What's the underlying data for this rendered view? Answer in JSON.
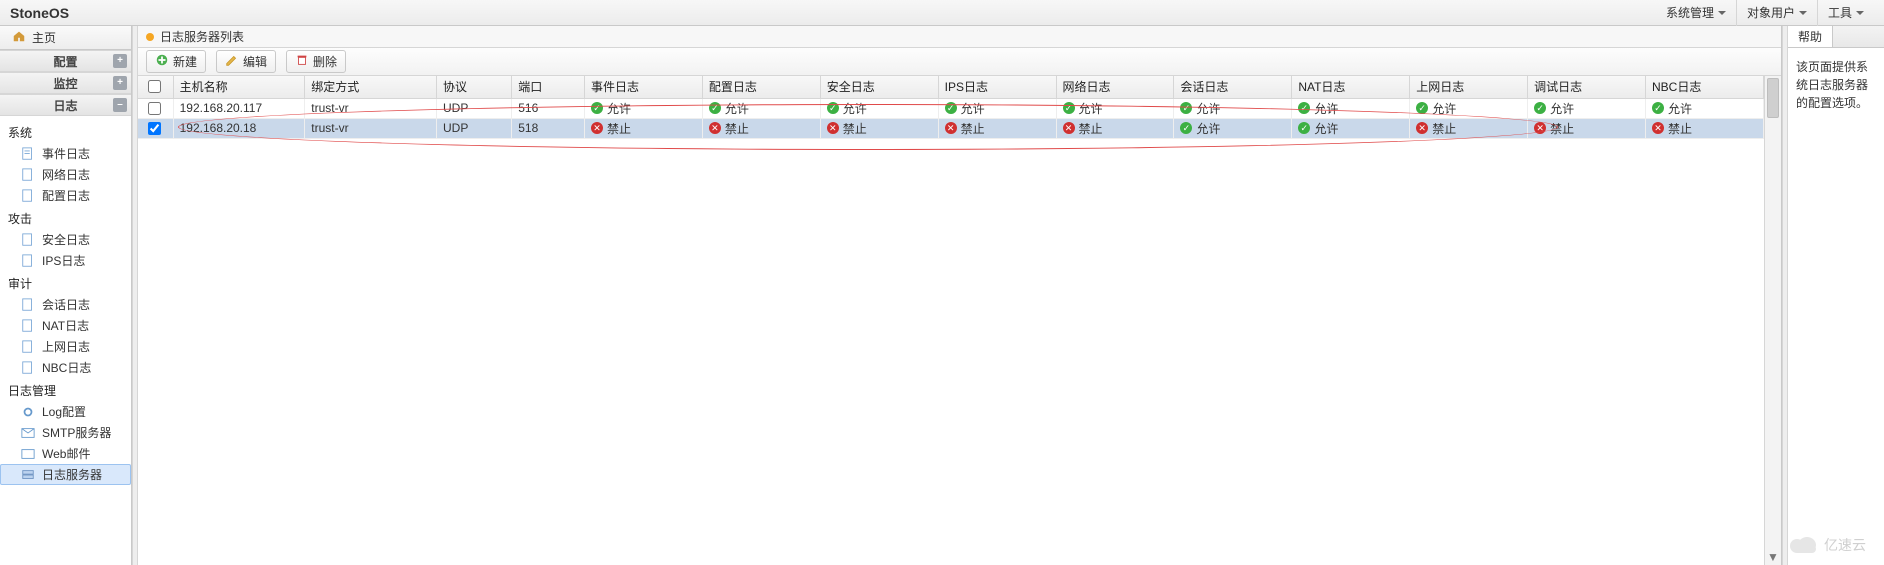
{
  "brand": "StoneOS",
  "top_menu": {
    "sys_mgmt": "系统管理",
    "target_user": "对象用户",
    "tools": "工具"
  },
  "home_tab": "主页",
  "accordion": {
    "config": {
      "label": "配置",
      "btn": "+"
    },
    "monitor": {
      "label": "监控",
      "btn": "+"
    },
    "log": {
      "label": "日志",
      "btn": "–"
    }
  },
  "tree": {
    "system": {
      "label": "系统",
      "items": [
        "事件日志",
        "网络日志",
        "配置日志"
      ]
    },
    "attack": {
      "label": "攻击",
      "items": [
        "安全日志",
        "IPS日志"
      ]
    },
    "audit": {
      "label": "审计",
      "items": [
        "会话日志",
        "NAT日志",
        "上网日志",
        "NBC日志"
      ]
    },
    "logmgmt": {
      "label": "日志管理",
      "items": [
        "Log配置",
        "SMTP服务器",
        "Web邮件",
        "日志服务器"
      ]
    }
  },
  "panel": {
    "title": "日志服务器列表",
    "toolbar": {
      "new": "新建",
      "edit": "编辑",
      "delete": "删除"
    }
  },
  "columns": [
    "主机名称",
    "绑定方式",
    "协议",
    "端口",
    "事件日志",
    "配置日志",
    "安全日志",
    "IPS日志",
    "网络日志",
    "会话日志",
    "NAT日志",
    "上网日志",
    "调试日志",
    "NBC日志"
  ],
  "status": {
    "allow": "允许",
    "deny": "禁止"
  },
  "rows": [
    {
      "checked": false,
      "host": "192.168.20.117",
      "bind": "trust-vr",
      "proto": "UDP",
      "port": "516",
      "flags": [
        "allow",
        "allow",
        "allow",
        "allow",
        "allow",
        "allow",
        "allow",
        "allow",
        "allow",
        "allow"
      ]
    },
    {
      "checked": true,
      "host": "192.168.20.18",
      "bind": "trust-vr",
      "proto": "UDP",
      "port": "518",
      "flags": [
        "deny",
        "deny",
        "deny",
        "deny",
        "deny",
        "allow",
        "allow",
        "deny",
        "deny",
        "deny"
      ]
    }
  ],
  "help": {
    "tab": "帮助",
    "body": "该页面提供系统日志服务器的配置选项。"
  },
  "watermark": "亿速云"
}
